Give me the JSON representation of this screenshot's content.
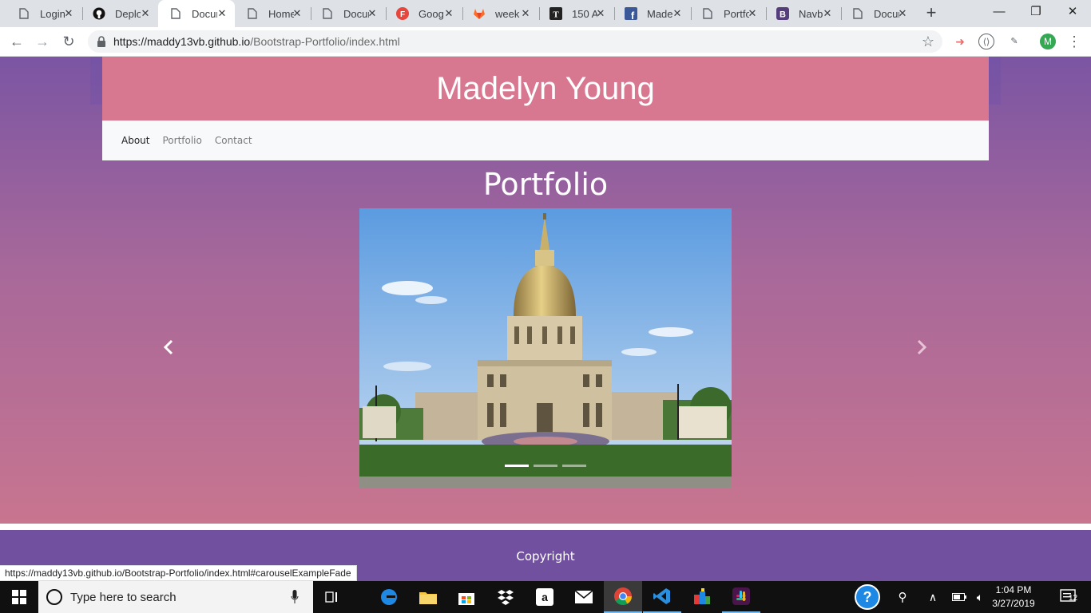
{
  "browser": {
    "tabs": [
      {
        "title": "Login",
        "icon": "doc-icon",
        "active": false
      },
      {
        "title": "Deplo",
        "icon": "github-icon",
        "active": false
      },
      {
        "title": "Docur",
        "icon": "doc-icon",
        "active": true
      },
      {
        "title": "Home",
        "icon": "doc-icon",
        "active": false
      },
      {
        "title": "Docur",
        "icon": "doc-icon",
        "active": false
      },
      {
        "title": "Goog",
        "icon": "google-forms-icon",
        "active": false
      },
      {
        "title": "week",
        "icon": "gitlab-icon",
        "active": false
      },
      {
        "title": "150 A",
        "icon": "t-icon",
        "active": false
      },
      {
        "title": "Made",
        "icon": "facebook-icon",
        "active": false
      },
      {
        "title": "Portfo",
        "icon": "doc-icon",
        "active": false
      },
      {
        "title": "Navb",
        "icon": "bootstrap-icon",
        "active": false
      },
      {
        "title": "Docur",
        "icon": "doc-icon",
        "active": false
      }
    ],
    "url_host": "https://maddy13vb.github.io",
    "url_path": "/Bootstrap-Portfolio/index.html",
    "profile_initial": "M",
    "status_url": "https://maddy13vb.github.io/Bootstrap-Portfolio/index.html#carouselExampleFade"
  },
  "page": {
    "site_title": "Madelyn Young",
    "nav": [
      {
        "label": "About",
        "active": true
      },
      {
        "label": "Portfolio",
        "active": false
      },
      {
        "label": "Contact",
        "active": false
      }
    ],
    "section_title": "Portfolio",
    "carousel": {
      "slide_count": 3,
      "active_index": 0,
      "image_description": "Les Invalides dome under blue sky"
    },
    "footer_text": "Copyright"
  },
  "taskbar": {
    "search_placeholder": "Type here to search",
    "time": "1:04 PM",
    "date": "3/27/2019",
    "notification_count": "12"
  },
  "colors": {
    "header_pink": "#d87890",
    "gradient_top": "#7b55a3",
    "gradient_bottom": "#c8758f",
    "footer_purple": "#71519f"
  }
}
